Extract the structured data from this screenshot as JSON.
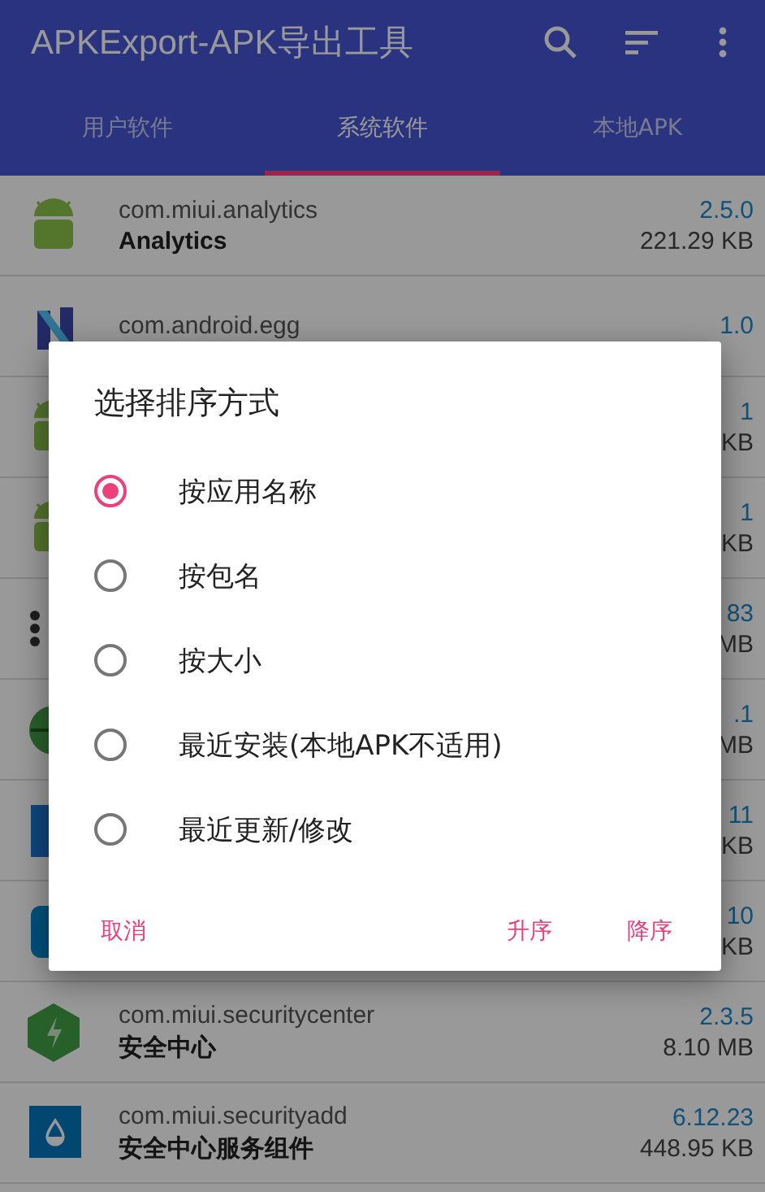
{
  "app_bar": {
    "title": "APKExport-APK导出工具"
  },
  "tabs": [
    {
      "label": "用户软件",
      "selected": false
    },
    {
      "label": "系统软件",
      "selected": true
    },
    {
      "label": "本地APK",
      "selected": false
    }
  ],
  "apps": [
    {
      "kind": "android",
      "package": "com.miui.analytics",
      "name": "Analytics",
      "version": "2.5.0",
      "size": "221.29 KB"
    },
    {
      "kind": "n-logo",
      "package": "com.android.egg",
      "version": "1.0"
    },
    {
      "kind": "android",
      "version": "1",
      "size": "KB"
    },
    {
      "kind": "android",
      "version": "1",
      "size": "KB"
    },
    {
      "kind": "dark",
      "version": "83",
      "size": "MB"
    },
    {
      "kind": "globe",
      "version": ".1",
      "size": "MB"
    },
    {
      "kind": "tile",
      "version": "11",
      "size": "KB"
    },
    {
      "kind": "rounded",
      "version": "10",
      "size": "KB"
    },
    {
      "kind": "hexagon",
      "package": "com.miui.securitycenter",
      "name": "安全中心",
      "version": "2.3.5",
      "size": "8.10 MB"
    },
    {
      "kind": "drop",
      "package": "com.miui.securityadd",
      "name": "安全中心服务组件",
      "version": "6.12.23",
      "size": "448.95 KB"
    }
  ],
  "dialog": {
    "title": "选择排序方式",
    "options": [
      {
        "label": "按应用名称",
        "selected": true
      },
      {
        "label": "按包名",
        "selected": false
      },
      {
        "label": "按大小",
        "selected": false
      },
      {
        "label": "最近安装(本地APK不适用)",
        "selected": false
      },
      {
        "label": "最近更新/修改",
        "selected": false
      }
    ],
    "buttons": [
      {
        "label": "取消"
      },
      {
        "label": "升序"
      },
      {
        "label": "降序"
      }
    ]
  }
}
